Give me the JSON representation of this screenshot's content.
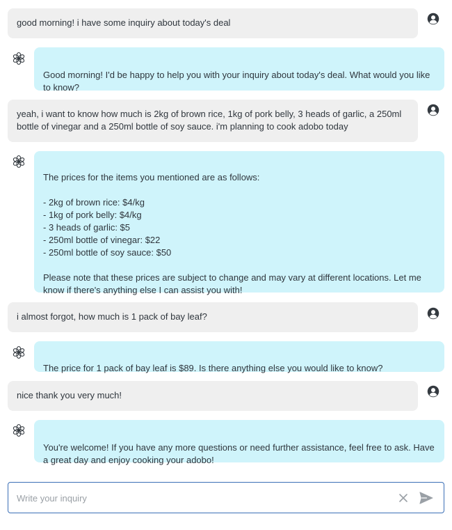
{
  "conversation": {
    "messages": [
      {
        "role": "user",
        "text": "good morning! i have some inquiry about today's deal"
      },
      {
        "role": "assistant",
        "text": "Good morning! I'd be happy to help you with your inquiry about today's deal. What would you like to know?"
      },
      {
        "role": "user",
        "text": "yeah, i want to know how much is 2kg of brown rice, 1kg of pork belly, 3 heads of garlic, a 250ml bottle of vinegar and a 250ml bottle of soy sauce. i'm planning to cook adobo today"
      },
      {
        "role": "assistant",
        "text": "The prices for the items you mentioned are as follows:\n\n- 2kg of brown rice: $4/kg\n- 1kg of pork belly: $4/kg\n- 3 heads of garlic: $5\n- 250ml bottle of vinegar: $22\n- 250ml bottle of soy sauce: $50\n\nPlease note that these prices are subject to change and may vary at different locations. Let me know if there's anything else I can assist you with!"
      },
      {
        "role": "user",
        "text": "i almost forgot, how much is 1 pack of bay leaf?"
      },
      {
        "role": "assistant",
        "text": "The price for 1 pack of bay leaf is $89. Is there anything else you would like to know?"
      },
      {
        "role": "user",
        "text": "nice thank you very much!"
      },
      {
        "role": "assistant",
        "text": "You're welcome! If you have any more questions or need further assistance, feel free to ask. Have a great day and enjoy cooking your adobo!"
      }
    ]
  },
  "input": {
    "placeholder": "Write your inquiry",
    "value": ""
  },
  "icons": {
    "user_avatar": "user-circle-icon",
    "assistant_avatar": "openai-logo-icon",
    "clear": "close-icon",
    "send": "send-icon"
  },
  "colors": {
    "user_bubble": "#efefef",
    "assistant_bubble": "#cff4fb",
    "input_border": "#3b6fb6"
  }
}
